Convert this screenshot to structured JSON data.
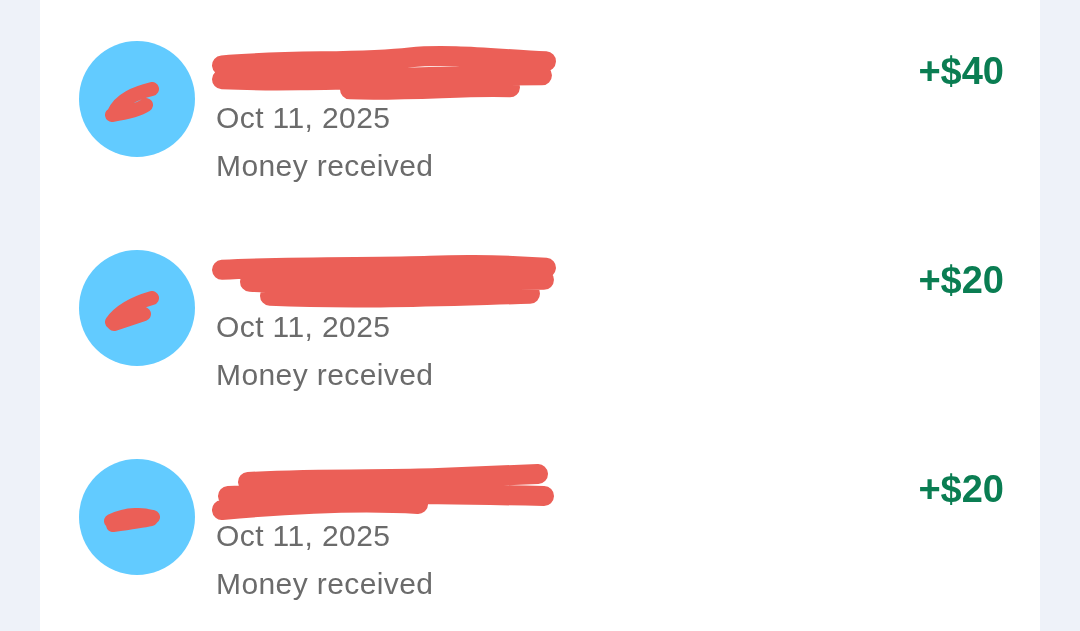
{
  "transactions": [
    {
      "redacted": true,
      "date": "Oct 11, 2025",
      "description": "Money received",
      "amount": "+$40"
    },
    {
      "redacted": true,
      "date": "Oct 11, 2025",
      "description": "Money received",
      "amount": "+$20"
    },
    {
      "redacted": true,
      "date": "Oct 11, 2025",
      "description": "Money received",
      "amount": "+$20"
    }
  ]
}
